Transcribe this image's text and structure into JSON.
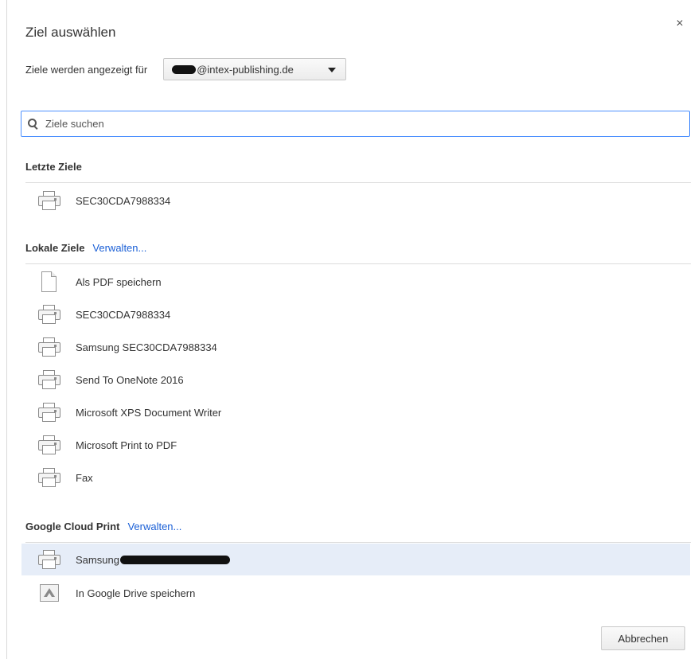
{
  "dialog": {
    "title": "Ziel auswählen",
    "close_glyph": "×"
  },
  "account": {
    "label": "Ziele werden angezeigt für",
    "selected_value": "@intex-publishing.de"
  },
  "search": {
    "placeholder": "Ziele suchen",
    "value": ""
  },
  "sections": {
    "recent": {
      "title": "Letzte Ziele",
      "items": [
        {
          "label": "SEC30CDA7988334",
          "icon": "printer-icon"
        }
      ]
    },
    "local": {
      "title": "Lokale Ziele",
      "manage_label": "Verwalten...",
      "items": [
        {
          "label": "Als PDF speichern",
          "icon": "pdf-document-icon"
        },
        {
          "label": "SEC30CDA7988334",
          "icon": "printer-icon"
        },
        {
          "label": "Samsung SEC30CDA7988334",
          "icon": "printer-icon"
        },
        {
          "label": "Send To OneNote 2016",
          "icon": "printer-icon"
        },
        {
          "label": "Microsoft XPS Document Writer",
          "icon": "printer-icon"
        },
        {
          "label": "Microsoft Print to PDF",
          "icon": "printer-icon"
        },
        {
          "label": "Fax",
          "icon": "printer-icon"
        }
      ]
    },
    "cloud": {
      "title": "Google Cloud Print",
      "manage_label": "Verwalten...",
      "items": [
        {
          "label": "Samsung",
          "icon": "printer-icon",
          "selected": true
        },
        {
          "label": "In Google Drive speichern",
          "icon": "google-drive-icon"
        }
      ]
    }
  },
  "footer": {
    "cancel_label": "Abbrechen"
  },
  "colors": {
    "link": "#1a5fd6",
    "focus_border": "#4d90fe",
    "selected_row": "#e6edf8"
  }
}
